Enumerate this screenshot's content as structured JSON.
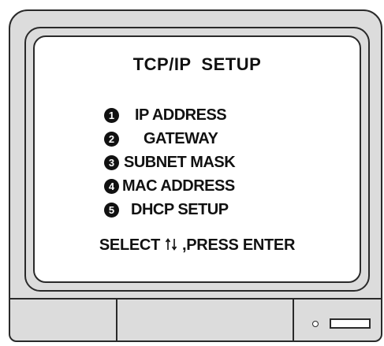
{
  "screen": {
    "title": "TCP/IP  SETUP",
    "menu": [
      {
        "number": "1",
        "icon": "circled-number-1-icon",
        "label": "IP ADDRESS"
      },
      {
        "number": "2",
        "icon": "circled-number-2-icon",
        "label": "GATEWAY"
      },
      {
        "number": "3",
        "icon": "circled-number-3-icon",
        "label": "SUBNET MASK"
      },
      {
        "number": "4",
        "icon": "circled-number-4-icon",
        "label": "MAC ADDRESS"
      },
      {
        "number": "5",
        "icon": "circled-number-5-icon",
        "label": "DHCP SETUP"
      }
    ],
    "hint": {
      "select_text": "SELECT",
      "arrows_icon": "up-down-arrows-icon",
      "press_text": ",PRESS ENTER"
    }
  },
  "colors": {
    "outline": "#2a2a2a",
    "screen_background": "#ffffff",
    "bezel": "#dcdcdc",
    "text": "#111111"
  }
}
